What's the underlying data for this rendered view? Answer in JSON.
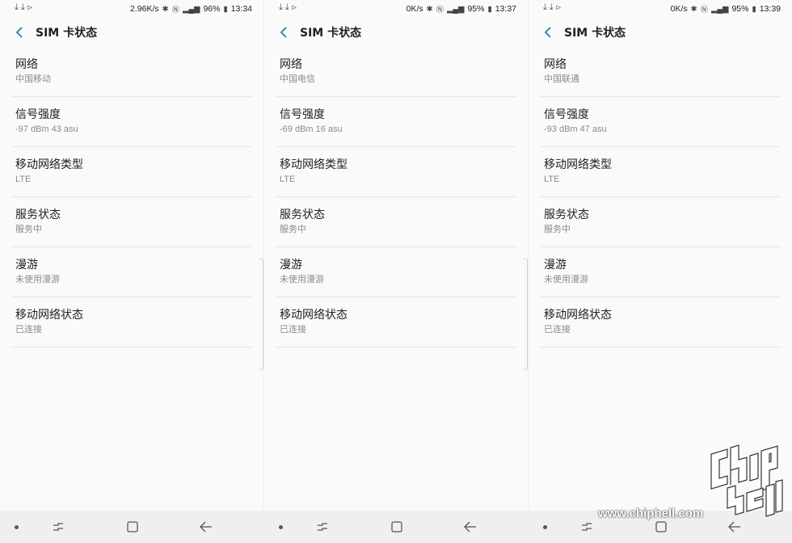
{
  "panels": [
    {
      "status": {
        "speed": "2.96K/s",
        "battery": "96%",
        "time": "13:34"
      },
      "title": "SIM 卡状态",
      "items": [
        {
          "label": "网络",
          "value": "中国移动"
        },
        {
          "label": "信号强度",
          "value": "-97 dBm 43 asu"
        },
        {
          "label": "移动网络类型",
          "value": "LTE"
        },
        {
          "label": "服务状态",
          "value": "服务中"
        },
        {
          "label": "漫游",
          "value": "未使用漫游"
        },
        {
          "label": "移动网络状态",
          "value": "已连接"
        }
      ]
    },
    {
      "status": {
        "speed": "0K/s",
        "battery": "95%",
        "time": "13:37"
      },
      "title": "SIM 卡状态",
      "items": [
        {
          "label": "网络",
          "value": "中国电信"
        },
        {
          "label": "信号强度",
          "value": "-69 dBm 16 asu"
        },
        {
          "label": "移动网络类型",
          "value": "LTE"
        },
        {
          "label": "服务状态",
          "value": "服务中"
        },
        {
          "label": "漫游",
          "value": "未使用漫游"
        },
        {
          "label": "移动网络状态",
          "value": "已连接"
        }
      ]
    },
    {
      "status": {
        "speed": "0K/s",
        "battery": "95%",
        "time": "13:39"
      },
      "title": "SIM 卡状态",
      "items": [
        {
          "label": "网络",
          "value": "中国联通"
        },
        {
          "label": "信号强度",
          "value": "-93 dBm 47 asu"
        },
        {
          "label": "移动网络类型",
          "value": "LTE"
        },
        {
          "label": "服务状态",
          "value": "服务中"
        },
        {
          "label": "漫游",
          "value": "未使用漫游"
        },
        {
          "label": "移动网络状态",
          "value": "已连接"
        }
      ]
    }
  ],
  "watermark": {
    "url": "www.chiphell.com"
  },
  "colors": {
    "accent": "#2a7fa0",
    "background": "#fafafa",
    "navbar": "#efefef"
  }
}
